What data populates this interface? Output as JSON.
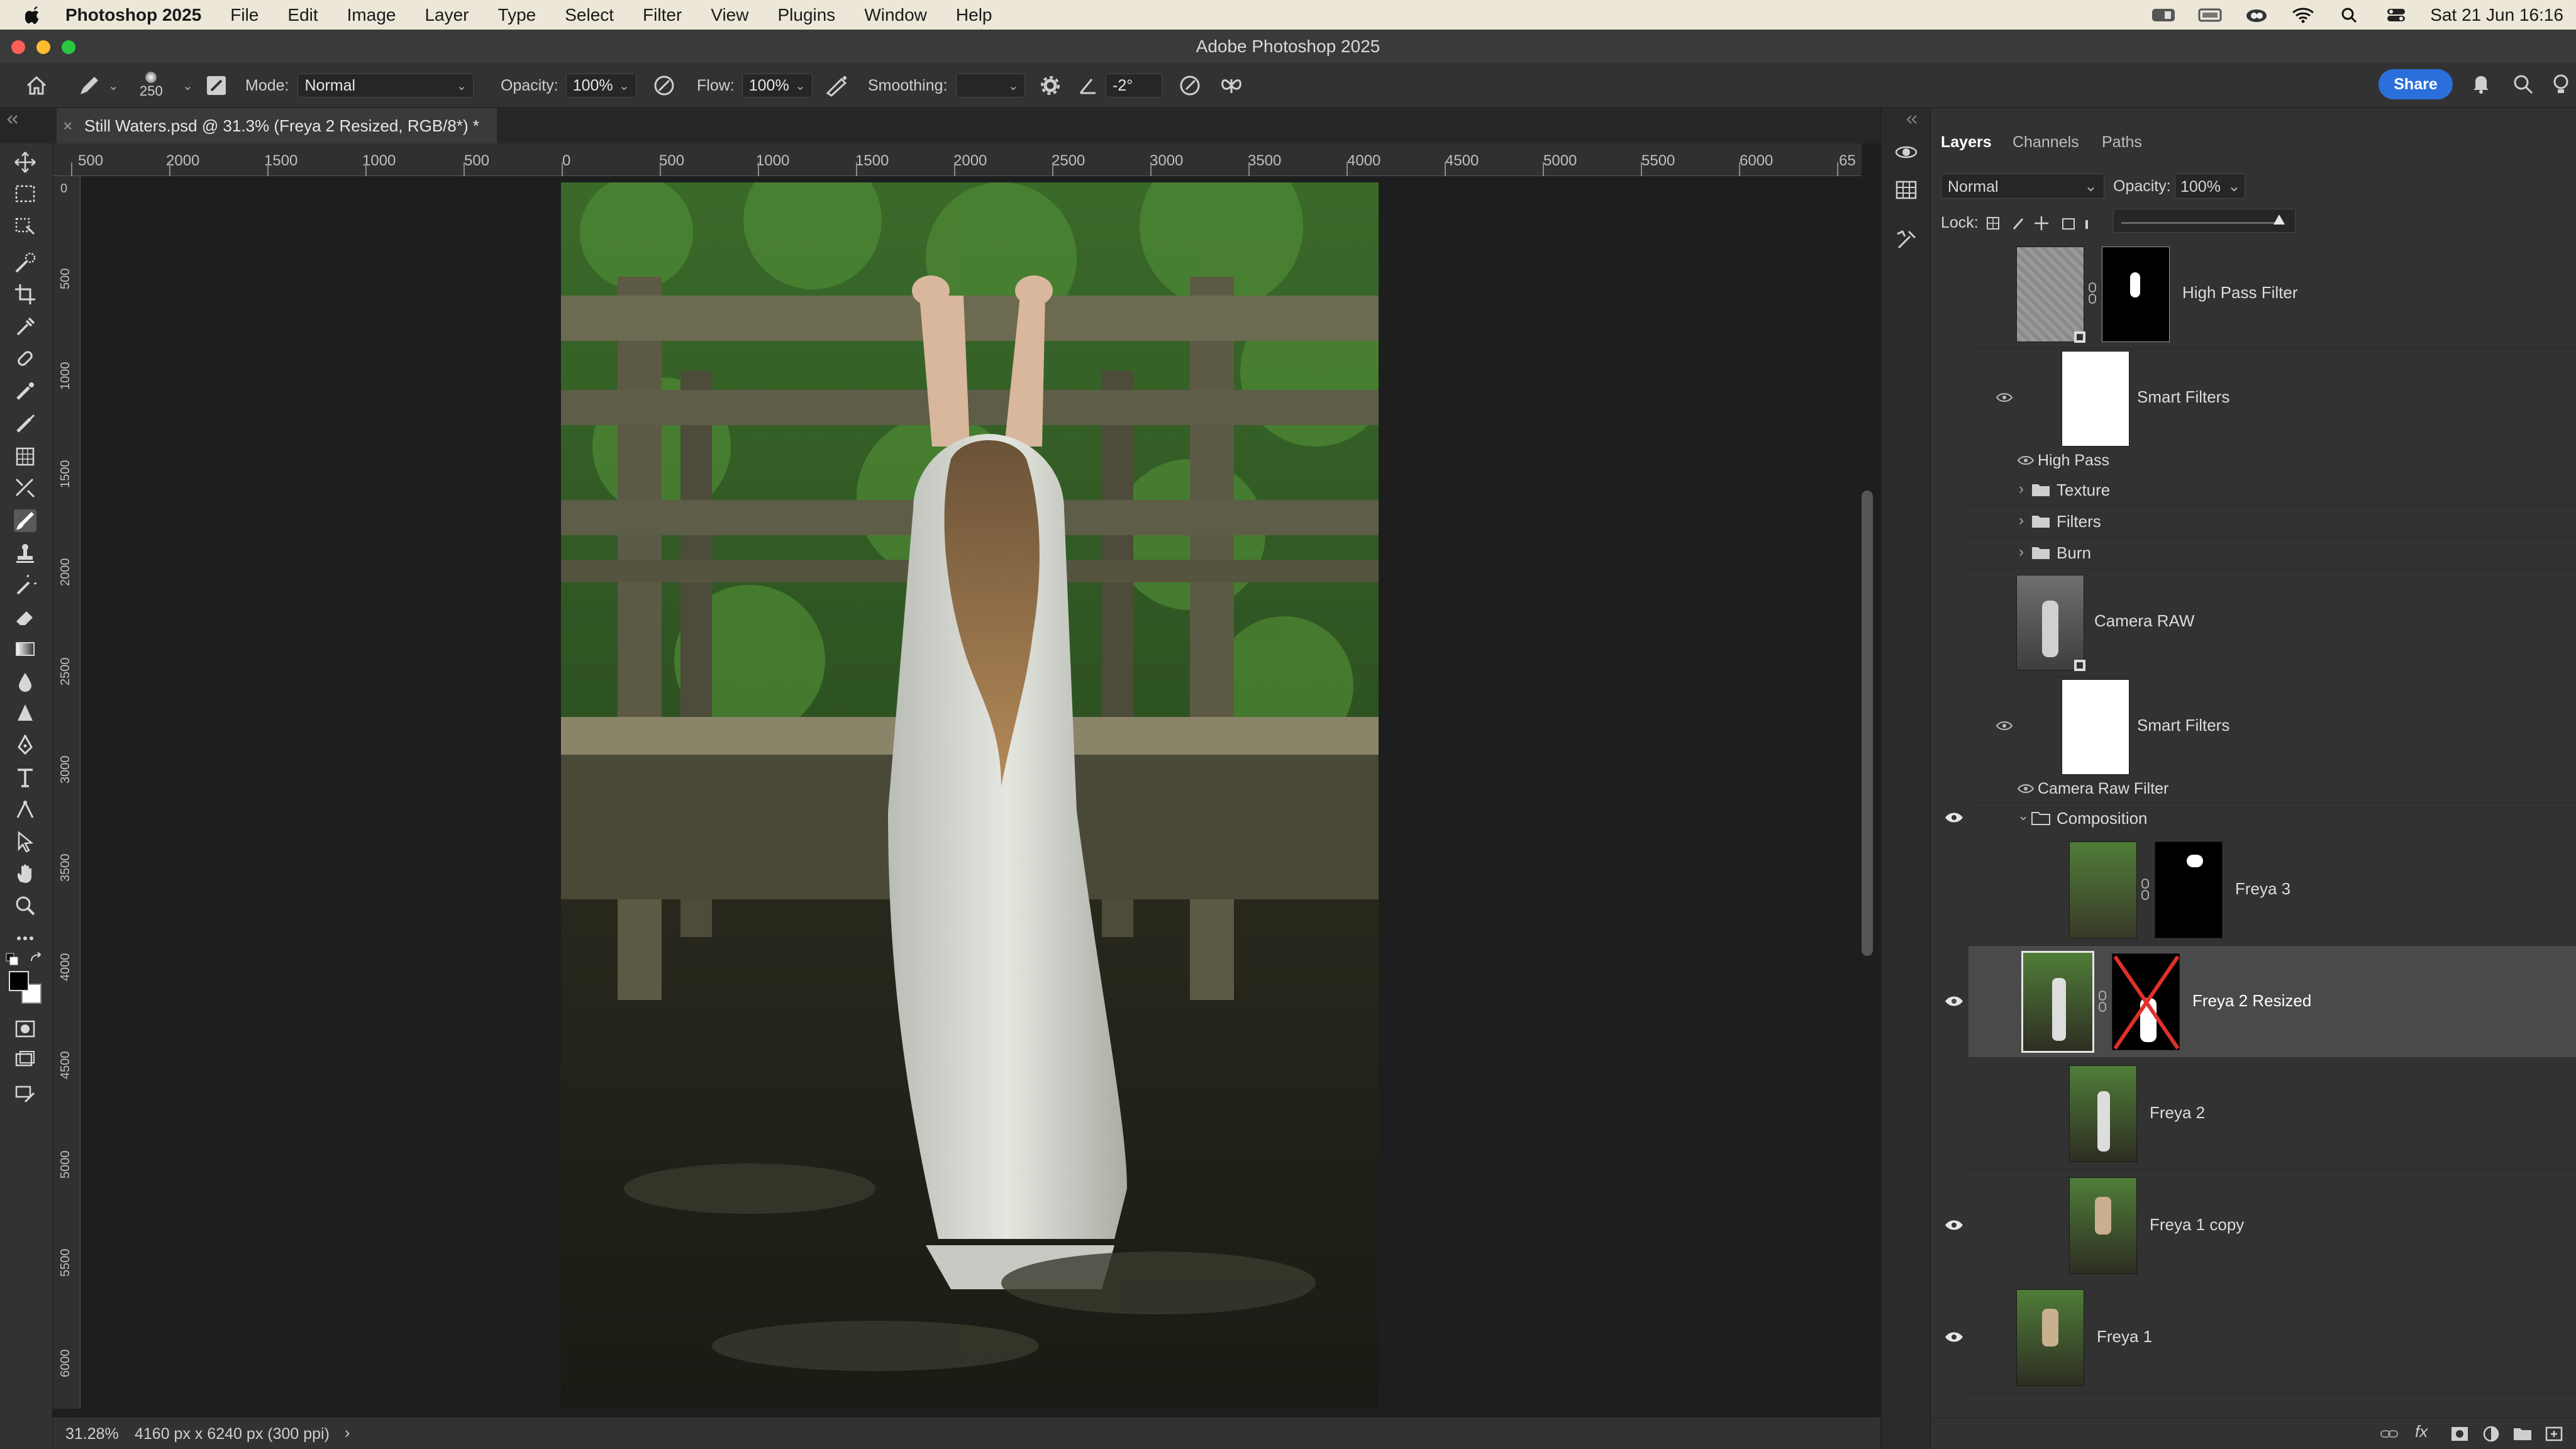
{
  "menubar": {
    "app_name": "Photoshop 2025",
    "menus": [
      "File",
      "Edit",
      "Image",
      "Layer",
      "Type",
      "Select",
      "Filter",
      "View",
      "Plugins",
      "Window",
      "Help"
    ],
    "clock": "Sat 21 Jun  16:16"
  },
  "window": {
    "title": "Adobe Photoshop 2025"
  },
  "options": {
    "brush_size": "250",
    "mode_label": "Mode:",
    "mode_value": "Normal",
    "opacity_label": "Opacity:",
    "opacity_value": "100%",
    "flow_label": "Flow:",
    "flow_value": "100%",
    "smoothing_label": "Smoothing:",
    "smoothing_value": "",
    "angle_value": "-2°",
    "share_label": "Share"
  },
  "document": {
    "tab_title": "Still Waters.psd @ 31.3% (Freya 2 Resized, RGB/8*) *",
    "close_glyph": "×"
  },
  "rulers": {
    "horizontal": [
      "500",
      "2000",
      "1500",
      "1000",
      "500",
      "0",
      "500",
      "1000",
      "1500",
      "2000",
      "2500",
      "3000",
      "3500",
      "4000",
      "4500",
      "5000",
      "5500",
      "6000",
      "65"
    ],
    "vertical": [
      "0",
      "500",
      "1000",
      "1500",
      "2000",
      "2500",
      "3000",
      "3500",
      "4000",
      "4500",
      "5000",
      "5500",
      "6000"
    ]
  },
  "status": {
    "zoom": "31.28%",
    "doc_info": "4160 px x 6240 px (300 ppi)",
    "arrow": "›"
  },
  "layers_panel": {
    "tabs": [
      "Layers",
      "Channels",
      "Paths"
    ],
    "blend_mode": "Normal",
    "opacity_label": "Opacity:",
    "opacity_value": "100%",
    "lock_label": "Lock:",
    "layers": [
      {
        "name": "High Pass Filter",
        "visible": false
      },
      {
        "name": "Smart Filters",
        "visible": true
      },
      {
        "name": "High Pass",
        "visible": true
      },
      {
        "name": "Texture",
        "visible": false
      },
      {
        "name": "Filters",
        "visible": false
      },
      {
        "name": "Burn",
        "visible": false
      },
      {
        "name": "Camera RAW",
        "visible": false
      },
      {
        "name": "Smart Filters",
        "visible": true
      },
      {
        "name": "Camera Raw Filter",
        "visible": true
      },
      {
        "name": "Composition",
        "visible": true
      },
      {
        "name": "Freya 3",
        "visible": false
      },
      {
        "name": "Freya 2 Resized",
        "visible": true
      },
      {
        "name": "Freya 2",
        "visible": false
      },
      {
        "name": "Freya 1 copy",
        "visible": true
      },
      {
        "name": "Freya 1",
        "visible": true
      }
    ]
  },
  "colors": {
    "accent": "#2a6fdb",
    "panel_bg": "#323232",
    "canvas_bg": "#1e1e1e",
    "selected_row": "#4a4a4a"
  }
}
